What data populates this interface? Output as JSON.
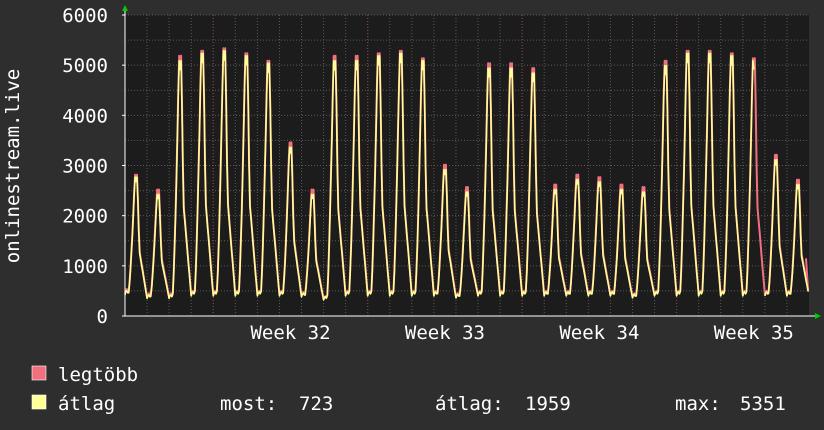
{
  "chart_data": {
    "type": "line",
    "ylabel": "onlinestream.live",
    "ylim": [
      0,
      6000
    ],
    "yticks": [
      0,
      1000,
      2000,
      3000,
      4000,
      5000,
      6000
    ],
    "x_week_labels": [
      "Week 32",
      "Week 33",
      "Week 34",
      "Week 35"
    ],
    "grid": true,
    "colors": {
      "background": "#2e2e2e",
      "plot_background": "#1c1c1c",
      "grid": "#5a5a5a",
      "axis": "#ffffff",
      "arrow": "#00cc00",
      "max_series": "#f07080",
      "avg_series": "#ffff99"
    },
    "series": [
      {
        "name": "legtöbb",
        "color": "#f07080",
        "peaks": [
          2850,
          2550,
          5250,
          5350,
          5400,
          5300,
          5150,
          3500,
          2550,
          5250,
          5250,
          5300,
          5350,
          5200,
          3050,
          2600,
          5100,
          5100,
          5000,
          2650,
          2850,
          2800,
          2650,
          2600,
          5150,
          5350,
          5350,
          5300,
          5200,
          3250,
          2750
        ],
        "troughs": [
          450,
          380,
          380,
          420,
          420,
          420,
          420,
          420,
          400,
          330,
          420,
          420,
          420,
          420,
          420,
          380,
          420,
          420,
          420,
          420,
          420,
          420,
          420,
          380,
          420,
          420,
          420,
          420,
          420,
          420,
          420,
          420
        ],
        "last": 1150
      },
      {
        "name": "átlag",
        "color": "#ffff99",
        "peaks": [
          2800,
          2450,
          5150,
          5300,
          5350,
          5250,
          5100,
          3400,
          2450,
          5150,
          5150,
          5250,
          5300,
          5150,
          2950,
          2500,
          5000,
          5000,
          4900,
          2550,
          2750,
          2700,
          2550,
          2500,
          5050,
          5300,
          5300,
          5250,
          5150,
          3150,
          2650
        ],
        "troughs": [
          420,
          350,
          350,
          400,
          400,
          400,
          400,
          400,
          380,
          320,
          400,
          400,
          400,
          400,
          400,
          360,
          400,
          400,
          400,
          400,
          400,
          400,
          400,
          360,
          400,
          400,
          400,
          400,
          400,
          400,
          400,
          400
        ],
        "last": 723,
        "gap_day_index": 28
      }
    ]
  },
  "legend": {
    "max_label": "legtöbb",
    "avg_label": "átlag"
  },
  "stats": {
    "now_label": "most:",
    "now_value": "723",
    "avg_label": "átlag:",
    "avg_value": "1959",
    "max_label": "max:",
    "max_value": "5351"
  }
}
